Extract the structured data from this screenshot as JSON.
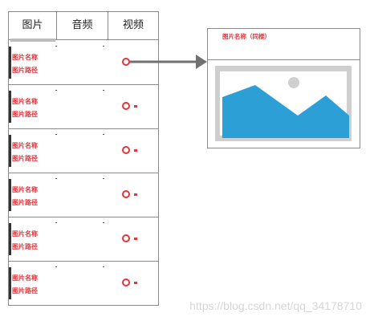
{
  "tabs": [
    {
      "label": "图片",
      "active": true
    },
    {
      "label": "音频",
      "active": false
    },
    {
      "label": "视频",
      "active": false
    }
  ],
  "items": [
    {
      "name": "图片名称",
      "path": "图片路径"
    },
    {
      "name": "图片名称",
      "path": "图片路径"
    },
    {
      "name": "图片名称",
      "path": "图片路径"
    },
    {
      "name": "图片名称",
      "path": "图片路径"
    },
    {
      "name": "图片名称",
      "path": "图片路径"
    },
    {
      "name": "图片名称",
      "path": "图片路径"
    }
  ],
  "preview": {
    "title": "图片名称（同楼）",
    "image_icon": "landscape-image-icon"
  },
  "watermark": "https://blog.csdn.net/qq_34178710",
  "colors": {
    "accent": "#e8333a",
    "image_blue": "#2b9fd6",
    "image_frame": "#cfcfcf",
    "border": "#8a8a8a",
    "arrow": "#707070"
  }
}
